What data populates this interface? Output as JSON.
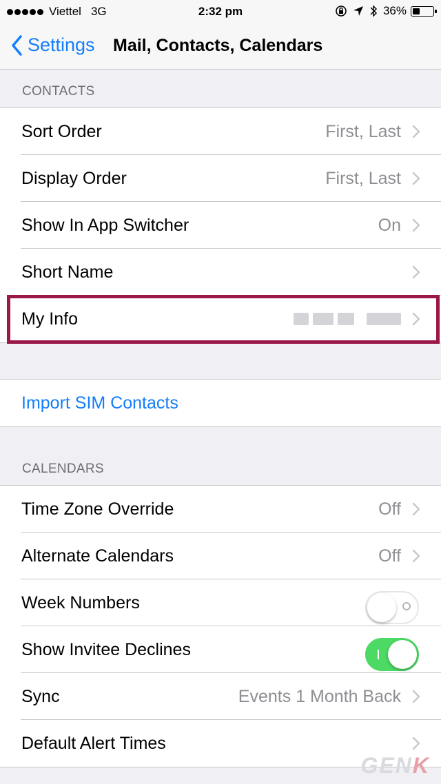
{
  "status_bar": {
    "carrier": "Viettel",
    "network": "3G",
    "time": "2:32 pm",
    "battery_text": "36%",
    "battery_level": 0.36,
    "signal_bars": 5,
    "icons": [
      "rotation-lock-icon",
      "location-icon",
      "bluetooth-icon"
    ]
  },
  "nav": {
    "back_label": "Settings",
    "title": "Mail, Contacts, Calendars"
  },
  "contacts": {
    "header": "CONTACTS",
    "rows": [
      {
        "label": "Sort Order",
        "value": "First, Last"
      },
      {
        "label": "Display Order",
        "value": "First, Last"
      },
      {
        "label": "Show In App Switcher",
        "value": "On"
      },
      {
        "label": "Short Name",
        "value": ""
      },
      {
        "label": "My Info",
        "value": ""
      }
    ]
  },
  "import": {
    "label": "Import SIM Contacts"
  },
  "calendars": {
    "header": "CALENDARS",
    "rows": [
      {
        "label": "Time Zone Override",
        "value": "Off"
      },
      {
        "label": "Alternate Calendars",
        "value": "Off"
      },
      {
        "label": "Week Numbers",
        "toggle": false
      },
      {
        "label": "Show Invitee Declines",
        "toggle": true
      },
      {
        "label": "Sync",
        "value": "Events 1 Month Back"
      },
      {
        "label": "Default Alert Times",
        "value": ""
      }
    ]
  },
  "colors": {
    "accent": "#147efb",
    "toggle_on": "#4cd964",
    "highlight": "#9b1748",
    "background": "#efeff4"
  },
  "watermark": {
    "text": "GENK"
  }
}
